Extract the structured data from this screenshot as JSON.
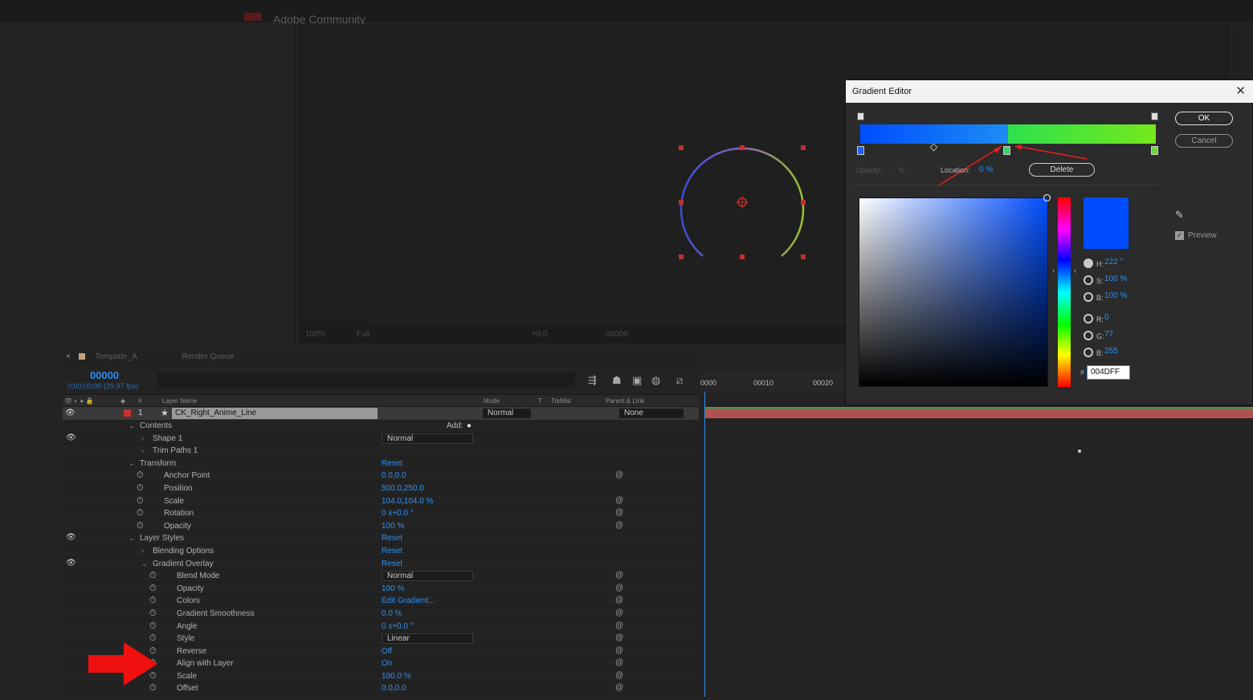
{
  "app": {
    "top_title": "Adobe Community"
  },
  "viewer": {
    "zoom": "100%",
    "resolution": "Full",
    "exposure": "+0.0",
    "timecode": "00000"
  },
  "timeline": {
    "tabs": [
      "Template_A",
      "Render Queue"
    ],
    "timecode": "00000",
    "timecode_sub": "0;00;00;00 (29.97 fps)",
    "columns": {
      "layer_name": "Layer Name",
      "num": "#",
      "mode": "Mode",
      "t": "T",
      "trkmat": "TrkMat",
      "parent": "Parent & Link"
    },
    "ruler": [
      "0000",
      "00010",
      "00020"
    ],
    "layer": {
      "index": "1",
      "name": "CK_Right_Anime_Line",
      "mode": "Normal",
      "parent": "None"
    },
    "add_label": "Add:",
    "properties": [
      {
        "indent": 1,
        "name": "Contents",
        "value": "",
        "twirl": "open"
      },
      {
        "indent": 2,
        "name": "Shape 1",
        "value": "Normal",
        "dropdown": true,
        "twirl": "closed",
        "eye": true
      },
      {
        "indent": 2,
        "name": "Trim Paths 1",
        "value": "",
        "twirl": "closed"
      },
      {
        "indent": 1,
        "name": "Transform",
        "value": "Reset",
        "twirl": "open"
      },
      {
        "indent": 3,
        "name": "Anchor Point",
        "value": "0.0,0.0",
        "stopwatch": true,
        "link": true
      },
      {
        "indent": 3,
        "name": "Position",
        "value": "500.0,250.0",
        "stopwatch": true
      },
      {
        "indent": 3,
        "name": "Scale",
        "value": "104.0,104.0 %",
        "stopwatch": true,
        "link": true
      },
      {
        "indent": 3,
        "name": "Rotation",
        "value": "0 x+0.0 °",
        "stopwatch": true,
        "link": true
      },
      {
        "indent": 3,
        "name": "Opacity",
        "value": "100 %",
        "stopwatch": true,
        "link": true
      },
      {
        "indent": 1,
        "name": "Layer Styles",
        "value": "Reset",
        "twirl": "open",
        "eye": true
      },
      {
        "indent": 2,
        "name": "Blending Options",
        "value": "Reset",
        "twirl": "closed"
      },
      {
        "indent": 2,
        "name": "Gradient Overlay",
        "value": "Reset",
        "twirl": "open",
        "eye": true
      },
      {
        "indent": 4,
        "name": "Blend Mode",
        "value": "Normal",
        "dropdown": true,
        "stopwatch": true,
        "link": true
      },
      {
        "indent": 4,
        "name": "Opacity",
        "value": "100 %",
        "stopwatch": true,
        "link": true
      },
      {
        "indent": 4,
        "name": "Colors",
        "value": "Edit Gradient...",
        "stopwatch": true,
        "link": true
      },
      {
        "indent": 4,
        "name": "Gradient Smoothness",
        "value": "0.0 %",
        "stopwatch": true,
        "link": true
      },
      {
        "indent": 4,
        "name": "Angle",
        "value": "0 x+0.0 °",
        "stopwatch": true,
        "link": true
      },
      {
        "indent": 4,
        "name": "Style",
        "value": "Linear",
        "dropdown": true,
        "stopwatch": true,
        "link": true
      },
      {
        "indent": 4,
        "name": "Reverse",
        "value": "Off",
        "stopwatch": true,
        "link": true
      },
      {
        "indent": 4,
        "name": "Align with Layer",
        "value": "On",
        "stopwatch": true,
        "link": true
      },
      {
        "indent": 4,
        "name": "Scale",
        "value": "100.0 %",
        "stopwatch": true,
        "link": true
      },
      {
        "indent": 4,
        "name": "Offset",
        "value": "0.0,0.0",
        "stopwatch": true,
        "link": true
      }
    ]
  },
  "gradient_editor": {
    "title": "Gradient Editor",
    "ok": "OK",
    "cancel": "Cancel",
    "opacity_label": "Opacity:",
    "opacity_value": "- %",
    "location_label": "Location:",
    "location_value": "0 %",
    "delete": "Delete",
    "preview": "Preview",
    "h_label": "H:",
    "h_value": "222 °",
    "s_label": "S:",
    "s_value": "100 %",
    "b_label": "B:",
    "b_value": "100 %",
    "r_label": "R:",
    "r_value": "0",
    "g_label": "G:",
    "g_value": "77",
    "b2_label": "B:",
    "b2_value": "255",
    "hex_prefix": "#",
    "hex": "004DFF",
    "colors": {
      "stop_left": "#004dff",
      "stop_right": "#76e81c",
      "selected": "#004dff"
    }
  }
}
